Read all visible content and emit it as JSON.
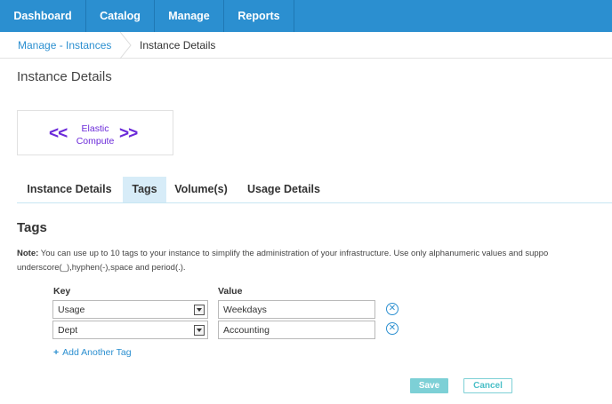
{
  "nav": {
    "items": [
      {
        "label": "Dashboard"
      },
      {
        "label": "Catalog"
      },
      {
        "label": "Manage"
      },
      {
        "label": "Reports"
      }
    ]
  },
  "breadcrumb": {
    "parent": "Manage - Instances",
    "current": "Instance Details"
  },
  "page": {
    "title": "Instance Details"
  },
  "logo": {
    "left_chevrons": "<<",
    "line1": "Elastic",
    "line2": "Compute",
    "right_chevrons": ">>"
  },
  "tabs": [
    {
      "label": "Instance Details",
      "active": false
    },
    {
      "label": "Tags",
      "active": true
    },
    {
      "label": "Volume(s)",
      "active": false
    },
    {
      "label": "Usage Details",
      "active": false
    }
  ],
  "tags_section": {
    "title": "Tags",
    "note_label": "Note:",
    "note_line1": " You can use up to 10 tags to your instance to simplify the administration of your infrastructure. Use only alphanumeric values and suppo",
    "note_line2": "underscore(_),hyphen(-),space and period(.).",
    "key_header": "Key",
    "value_header": "Value",
    "rows": [
      {
        "key": "Usage",
        "value": "Weekdays"
      },
      {
        "key": "Dept",
        "value": "Accounting"
      }
    ],
    "add_label": "Add Another Tag",
    "add_icon": "+"
  },
  "actions": {
    "save_label": "Save",
    "cancel_label": "Cancel"
  },
  "colors": {
    "nav_bg": "#2b8fd0",
    "link": "#2b8fd0",
    "active_tab_bg": "#d7ecf8",
    "logo_purple": "#6b2ad9",
    "button_teal": "#7dd0d6"
  }
}
